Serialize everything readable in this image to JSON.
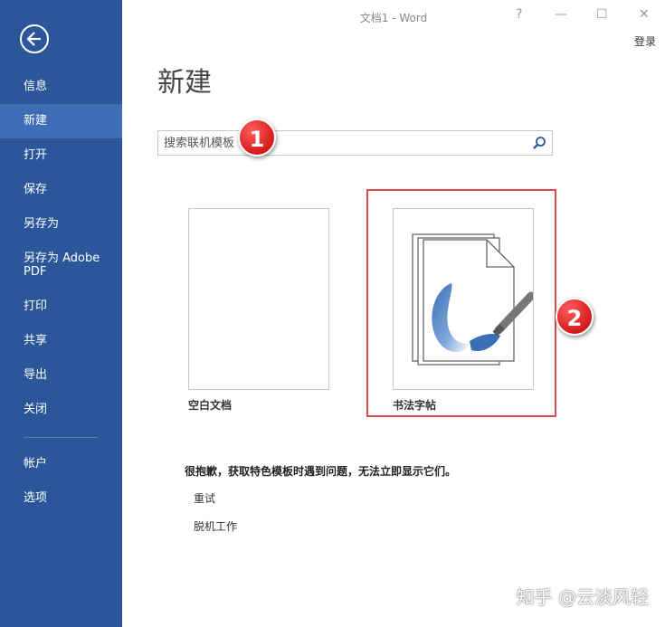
{
  "window": {
    "title": "文档1 - Word",
    "help_label": "?",
    "minimize_label": "—",
    "maximize_label": "☐",
    "close_label": "✕",
    "login_label": "登录"
  },
  "sidebar": {
    "back_icon": "back-arrow-icon",
    "items": [
      {
        "label": "信息"
      },
      {
        "label": "新建",
        "active": true
      },
      {
        "label": "打开"
      },
      {
        "label": "保存"
      },
      {
        "label": "另存为"
      },
      {
        "label": "另存为 Adobe PDF"
      },
      {
        "label": "打印"
      },
      {
        "label": "共享"
      },
      {
        "label": "导出"
      },
      {
        "label": "关闭"
      },
      {
        "label": "帐户"
      },
      {
        "label": "选项"
      }
    ]
  },
  "main": {
    "title": "新建",
    "search": {
      "placeholder": "搜索联机模板",
      "value": ""
    },
    "templates": [
      {
        "label": "空白文档"
      },
      {
        "label": "书法字帖"
      }
    ],
    "message": "很抱歉，获取特色模板时遇到问题，无法立即显示它们。",
    "retry_label": "重试",
    "offline_label": "脱机工作"
  },
  "annotations": {
    "badge1": "1",
    "badge2": "2"
  },
  "watermark": "知乎 @云淡风轻",
  "colors": {
    "sidebar": "#2b579a",
    "sidebar_active": "#3e6db5",
    "highlight": "#e0494e",
    "badge": "#d41b1b"
  }
}
